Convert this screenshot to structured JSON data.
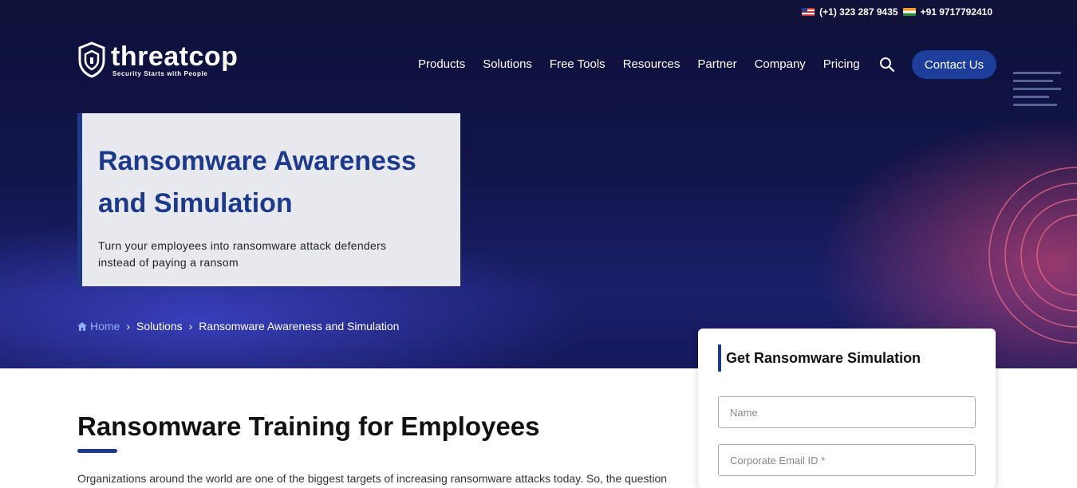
{
  "topbar": {
    "us_phone": "(+1) 323 287 9435",
    "in_phone": "+91 9717792410"
  },
  "logo": {
    "name": "threatcop",
    "tagline": "Security Starts with People"
  },
  "nav": {
    "items": [
      "Products",
      "Solutions",
      "Free Tools",
      "Resources",
      "Partner",
      "Company",
      "Pricing"
    ],
    "contact_label": "Contact Us"
  },
  "hero": {
    "title_line1": "Ransomware Awareness",
    "title_line2": "and Simulation",
    "subtitle_line1": "Turn your employees into ransomware attack defenders",
    "subtitle_line2": "instead of paying a ransom"
  },
  "breadcrumb": {
    "home": "Home",
    "solutions": "Solutions",
    "current": "Ransomware Awareness and Simulation"
  },
  "main": {
    "title": "Ransomware Training for Employees",
    "intro": "Organizations around the world are one of the biggest targets of increasing ransomware attacks today. So, the question"
  },
  "form": {
    "title": "Get Ransomware Simulation",
    "name_placeholder": "Name",
    "email_placeholder": "Corporate Email ID *"
  },
  "colors": {
    "accent": "#1d3a8a",
    "button": "#1d3e9a",
    "hero_bg": "#12154a"
  }
}
